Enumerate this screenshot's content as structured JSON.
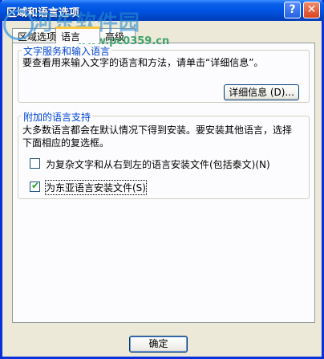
{
  "window": {
    "title": "区域和语言选项",
    "help_label": "?",
    "close_label": "✕"
  },
  "tabs": [
    {
      "label": "区域选项",
      "active": false
    },
    {
      "label": "语言",
      "active": true
    },
    {
      "label": "高级",
      "active": false
    }
  ],
  "text_services": {
    "legend": "文字服务和输入语言",
    "description": "要查看用来输入文字的语言和方法，请单击“详细信息”。",
    "details_button": "详细信息 (D)..."
  },
  "supplemental": {
    "legend": "附加的语言支持",
    "description_line1": "大多数语言都会在默认情况下得到安装。要安装其他语言，选择",
    "description_line2": "下面相应的复选框。",
    "options": [
      {
        "label": "为复杂文字和从右到左的语言安装文件(包括泰文)(N)",
        "checked": false
      },
      {
        "label": "为东亚语言安装文件(S)",
        "checked": true
      }
    ]
  },
  "footer": {
    "ok_button": "确定"
  },
  "watermark": {
    "text": "河东软件园",
    "url": "www.pc0359.cn"
  },
  "colors": {
    "titlebar": "#0054E3",
    "dialog_bg": "#ECE9D8",
    "legend_text": "#0046D5",
    "tab_highlight": "#FFC83C"
  }
}
